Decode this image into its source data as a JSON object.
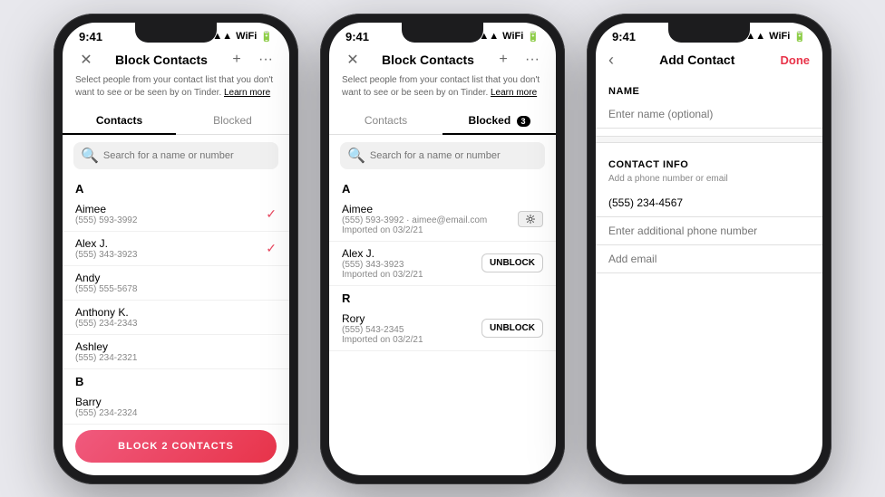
{
  "phones": [
    {
      "id": "phone1",
      "statusBar": {
        "time": "9:41",
        "signal": "▲▲▲",
        "wifi": "▲",
        "battery": "■■■"
      },
      "header": {
        "title": "Block Contacts",
        "leftIcon": "✕",
        "rightIcons": [
          "+",
          "···"
        ]
      },
      "subtitle": "Select people from your contact list that you don't want to see or be seen by on Tinder.",
      "subtitleLink": "Learn more",
      "tabs": [
        {
          "label": "Contacts",
          "active": true,
          "badge": null
        },
        {
          "label": "Blocked",
          "active": false,
          "badge": null
        }
      ],
      "search": {
        "placeholder": "Search for a name or number"
      },
      "sections": [
        {
          "letter": "A",
          "contacts": [
            {
              "name": "Aimee",
              "phone": "(555) 593-3992",
              "checked": true
            },
            {
              "name": "Alex J.",
              "phone": "(555) 343-3923",
              "checked": true
            },
            {
              "name": "Andy",
              "phone": "(555) 555-5678",
              "checked": false
            },
            {
              "name": "Anthony K.",
              "phone": "(555) 234-2343",
              "checked": false
            },
            {
              "name": "Ashley",
              "phone": "(555) 234-2321",
              "checked": false
            }
          ]
        },
        {
          "letter": "B",
          "contacts": [
            {
              "name": "Barry",
              "phone": "(555) 234-2324",
              "checked": false
            }
          ]
        }
      ],
      "blockButton": "BLOCK 2 CONTACTS"
    },
    {
      "id": "phone2",
      "statusBar": {
        "time": "9:41",
        "signal": "▲▲▲",
        "wifi": "▲",
        "battery": "■■■"
      },
      "header": {
        "title": "Block Contacts",
        "leftIcon": "✕",
        "rightIcons": [
          "+",
          "···"
        ]
      },
      "subtitle": "Select people from your contact list that you don't want to see or be seen by on Tinder.",
      "subtitleLink": "Learn more",
      "tabs": [
        {
          "label": "Contacts",
          "active": false,
          "badge": null
        },
        {
          "label": "Blocked",
          "active": true,
          "badge": "3"
        }
      ],
      "search": {
        "placeholder": "Search for a name or number"
      },
      "sections": [
        {
          "letter": "A",
          "contacts": [
            {
              "name": "Aimee",
              "phone": "(555) 593-3992",
              "extra": "aimee@email.com",
              "imported": "Imported on 03/2/21",
              "hasToggle": true,
              "unblock": false
            },
            {
              "name": "Alex J.",
              "phone": "(555) 343-3923",
              "imported": "Imported on 03/2/21",
              "hasToggle": false,
              "unblock": true
            }
          ]
        },
        {
          "letter": "R",
          "contacts": [
            {
              "name": "Rory",
              "phone": "(555) 543-2345",
              "imported": "Imported on 03/2/21",
              "hasToggle": false,
              "unblock": true
            }
          ]
        }
      ]
    },
    {
      "id": "phone3",
      "statusBar": {
        "time": "9:41",
        "signal": "▲▲▲",
        "wifi": "▲",
        "battery": "■■■"
      },
      "header": {
        "title": "Add Contact",
        "leftIcon": "‹",
        "doneLabel": "Done"
      },
      "nameSection": {
        "label": "NAME",
        "placeholder": "Enter name (optional)"
      },
      "contactInfoSection": {
        "label": "CONTACT INFO",
        "sublabel": "Add a phone number or email",
        "fields": [
          {
            "value": "(555) 234-4567",
            "placeholder": "(555) 234-4567",
            "filled": true
          },
          {
            "value": "",
            "placeholder": "Enter additional phone number",
            "filled": false
          },
          {
            "value": "",
            "placeholder": "Add email",
            "filled": false
          }
        ]
      }
    }
  ]
}
